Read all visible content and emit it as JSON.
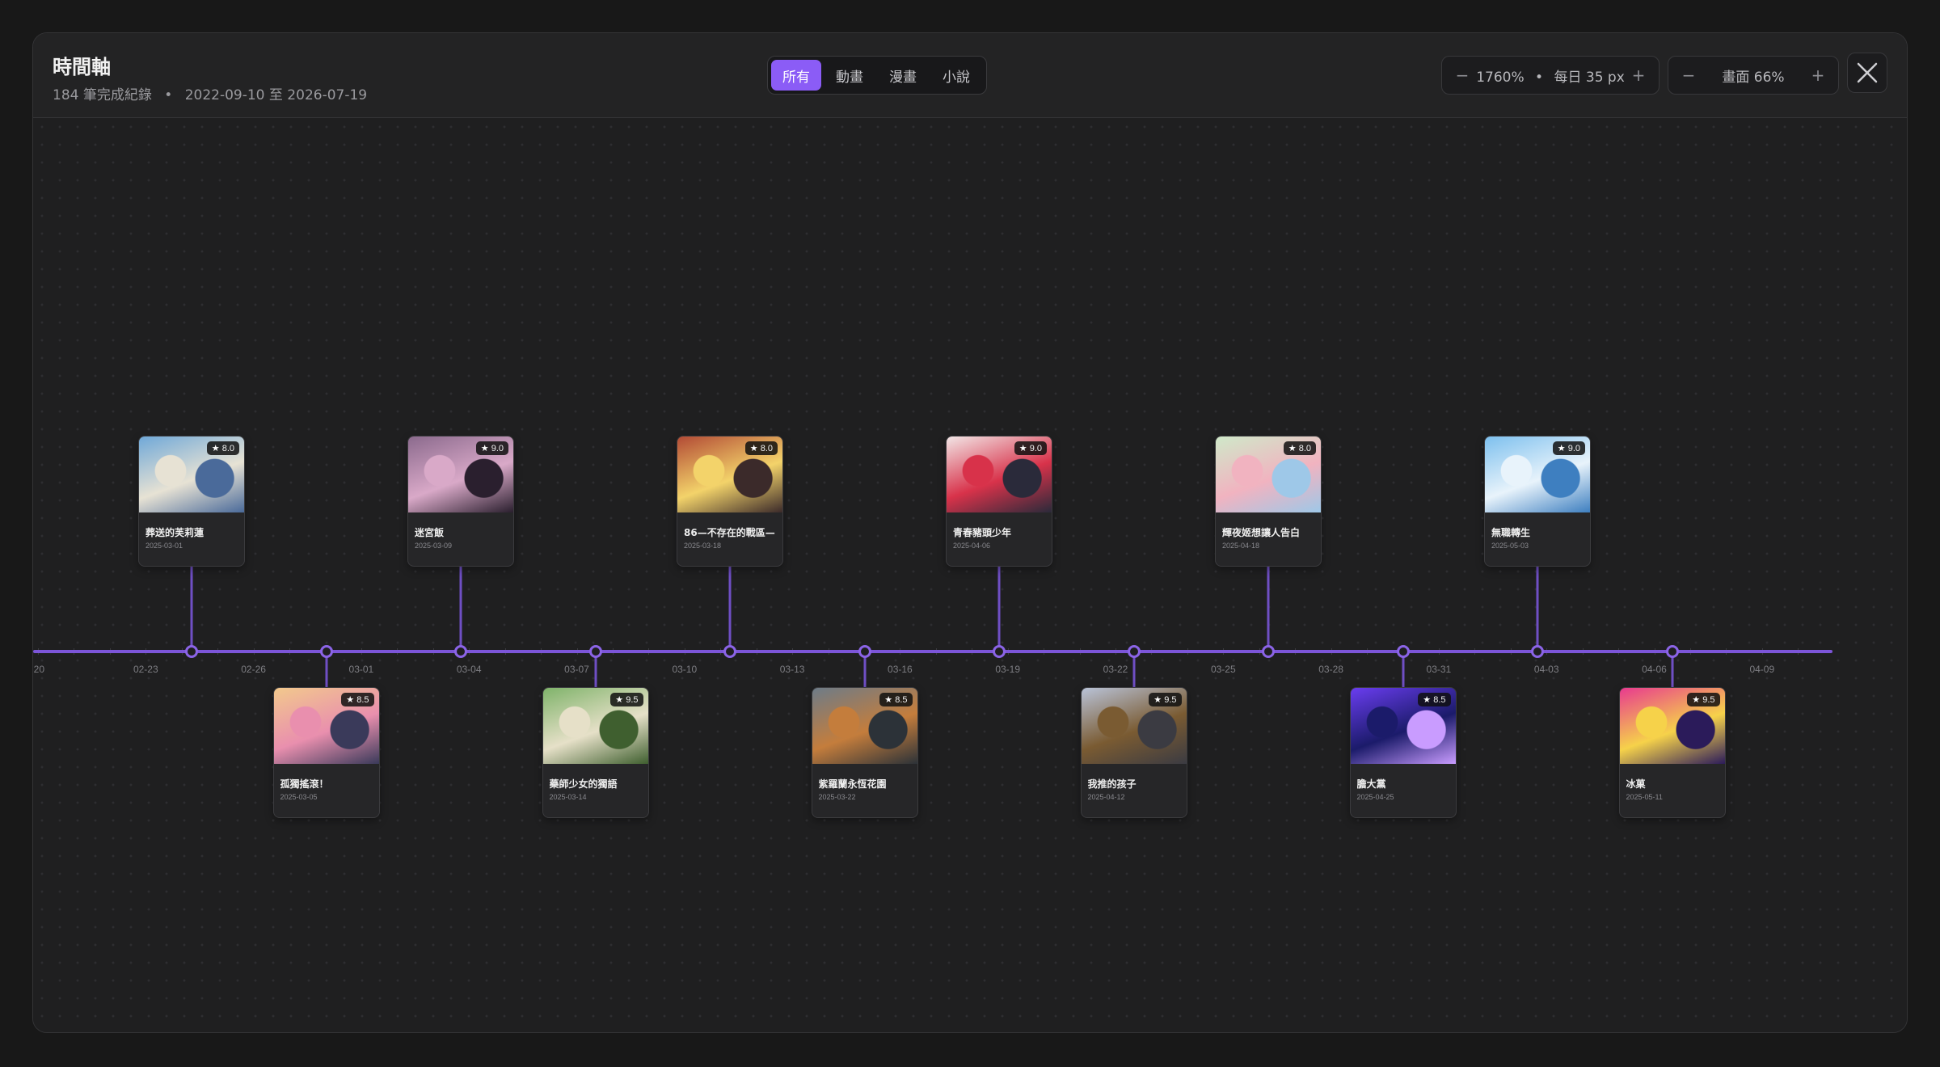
{
  "header": {
    "title": "時間軸",
    "subtitle_count": "184 筆完成紀錄",
    "subtitle_separator": "•",
    "subtitle_range": "2022-09-10 至 2026-07-19"
  },
  "filters": [
    {
      "label": "所有",
      "active": true
    },
    {
      "label": "動畫",
      "active": false
    },
    {
      "label": "漫畫",
      "active": false
    },
    {
      "label": "小說",
      "active": false
    }
  ],
  "zoom_control": {
    "minus": "−",
    "value": "1760%",
    "separator": "•",
    "per_day": "每日 35 px",
    "plus": "+"
  },
  "screen_control": {
    "minus": "−",
    "value": "畫面 66%",
    "plus": "+"
  },
  "close_label": "×",
  "colors": {
    "accent": "#8b5cf6",
    "axis": "#7c55d8",
    "background": "#1f1f20"
  },
  "axis_ticks": [
    "20",
    "02-23",
    "02-26",
    "03-01",
    "03-04",
    "03-07",
    "03-10",
    "03-13",
    "03-16",
    "03-19",
    "03-22",
    "03-25",
    "03-28",
    "03-31",
    "04-03",
    "04-06",
    "04-09"
  ],
  "entries": [
    {
      "title": "葬送的芙莉蓮",
      "date": "2025-03-01",
      "rating": "8.0",
      "position": "top",
      "palette": [
        "#6fa8d8",
        "#e7e2d4",
        "#4a6a9a"
      ]
    },
    {
      "title": "孤獨搖滾！",
      "date": "2025-03-05",
      "rating": "8.5",
      "position": "bottom",
      "palette": [
        "#f2c98c",
        "#e98fae",
        "#3a3a5a"
      ]
    },
    {
      "title": "迷宮飯",
      "date": "2025-03-09",
      "rating": "9.0",
      "position": "top",
      "palette": [
        "#8b6a8d",
        "#d9a9c8",
        "#2a1f2e"
      ]
    },
    {
      "title": "藥師少女的獨語",
      "date": "2025-03-14",
      "rating": "9.5",
      "position": "bottom",
      "palette": [
        "#7fb36a",
        "#e6e0c8",
        "#3f5f2f"
      ]
    },
    {
      "title": "86—不存在的戰區—",
      "date": "2025-03-18",
      "rating": "8.0",
      "position": "top",
      "palette": [
        "#b24a35",
        "#f3d36a",
        "#3b2a2a"
      ]
    },
    {
      "title": "紫羅蘭永恆花園",
      "date": "2025-03-22",
      "rating": "8.5",
      "position": "bottom",
      "palette": [
        "#6d7c88",
        "#c47d3c",
        "#2c3238"
      ]
    },
    {
      "title": "青春豬頭少年",
      "date": "2025-04-06",
      "rating": "9.0",
      "position": "top",
      "palette": [
        "#f2e6e6",
        "#d8324a",
        "#2a2a3a"
      ]
    },
    {
      "title": "我推的孩子",
      "date": "2025-04-12",
      "rating": "9.5",
      "position": "bottom",
      "palette": [
        "#b9c3d8",
        "#7a5b32",
        "#3b3b42"
      ]
    },
    {
      "title": "輝夜姬想讓人告白",
      "date": "2025-04-18",
      "rating": "8.0",
      "position": "top",
      "palette": [
        "#cfe9c9",
        "#f1b3c0",
        "#9ec8e8"
      ]
    },
    {
      "title": "膽大黨",
      "date": "2025-04-25",
      "rating": "8.5",
      "position": "bottom",
      "palette": [
        "#6a3df0",
        "#1b1b6a",
        "#c99cff"
      ]
    },
    {
      "title": "無職轉生",
      "date": "2025-05-03",
      "rating": "9.0",
      "position": "top",
      "palette": [
        "#7dc0ee",
        "#e8f3fb",
        "#3e7fc0"
      ]
    },
    {
      "title": "冰菓",
      "date": "2025-05-11",
      "rating": "9.5",
      "position": "bottom",
      "palette": [
        "#e83a8f",
        "#f6d24a",
        "#2b1b5a"
      ]
    }
  ]
}
